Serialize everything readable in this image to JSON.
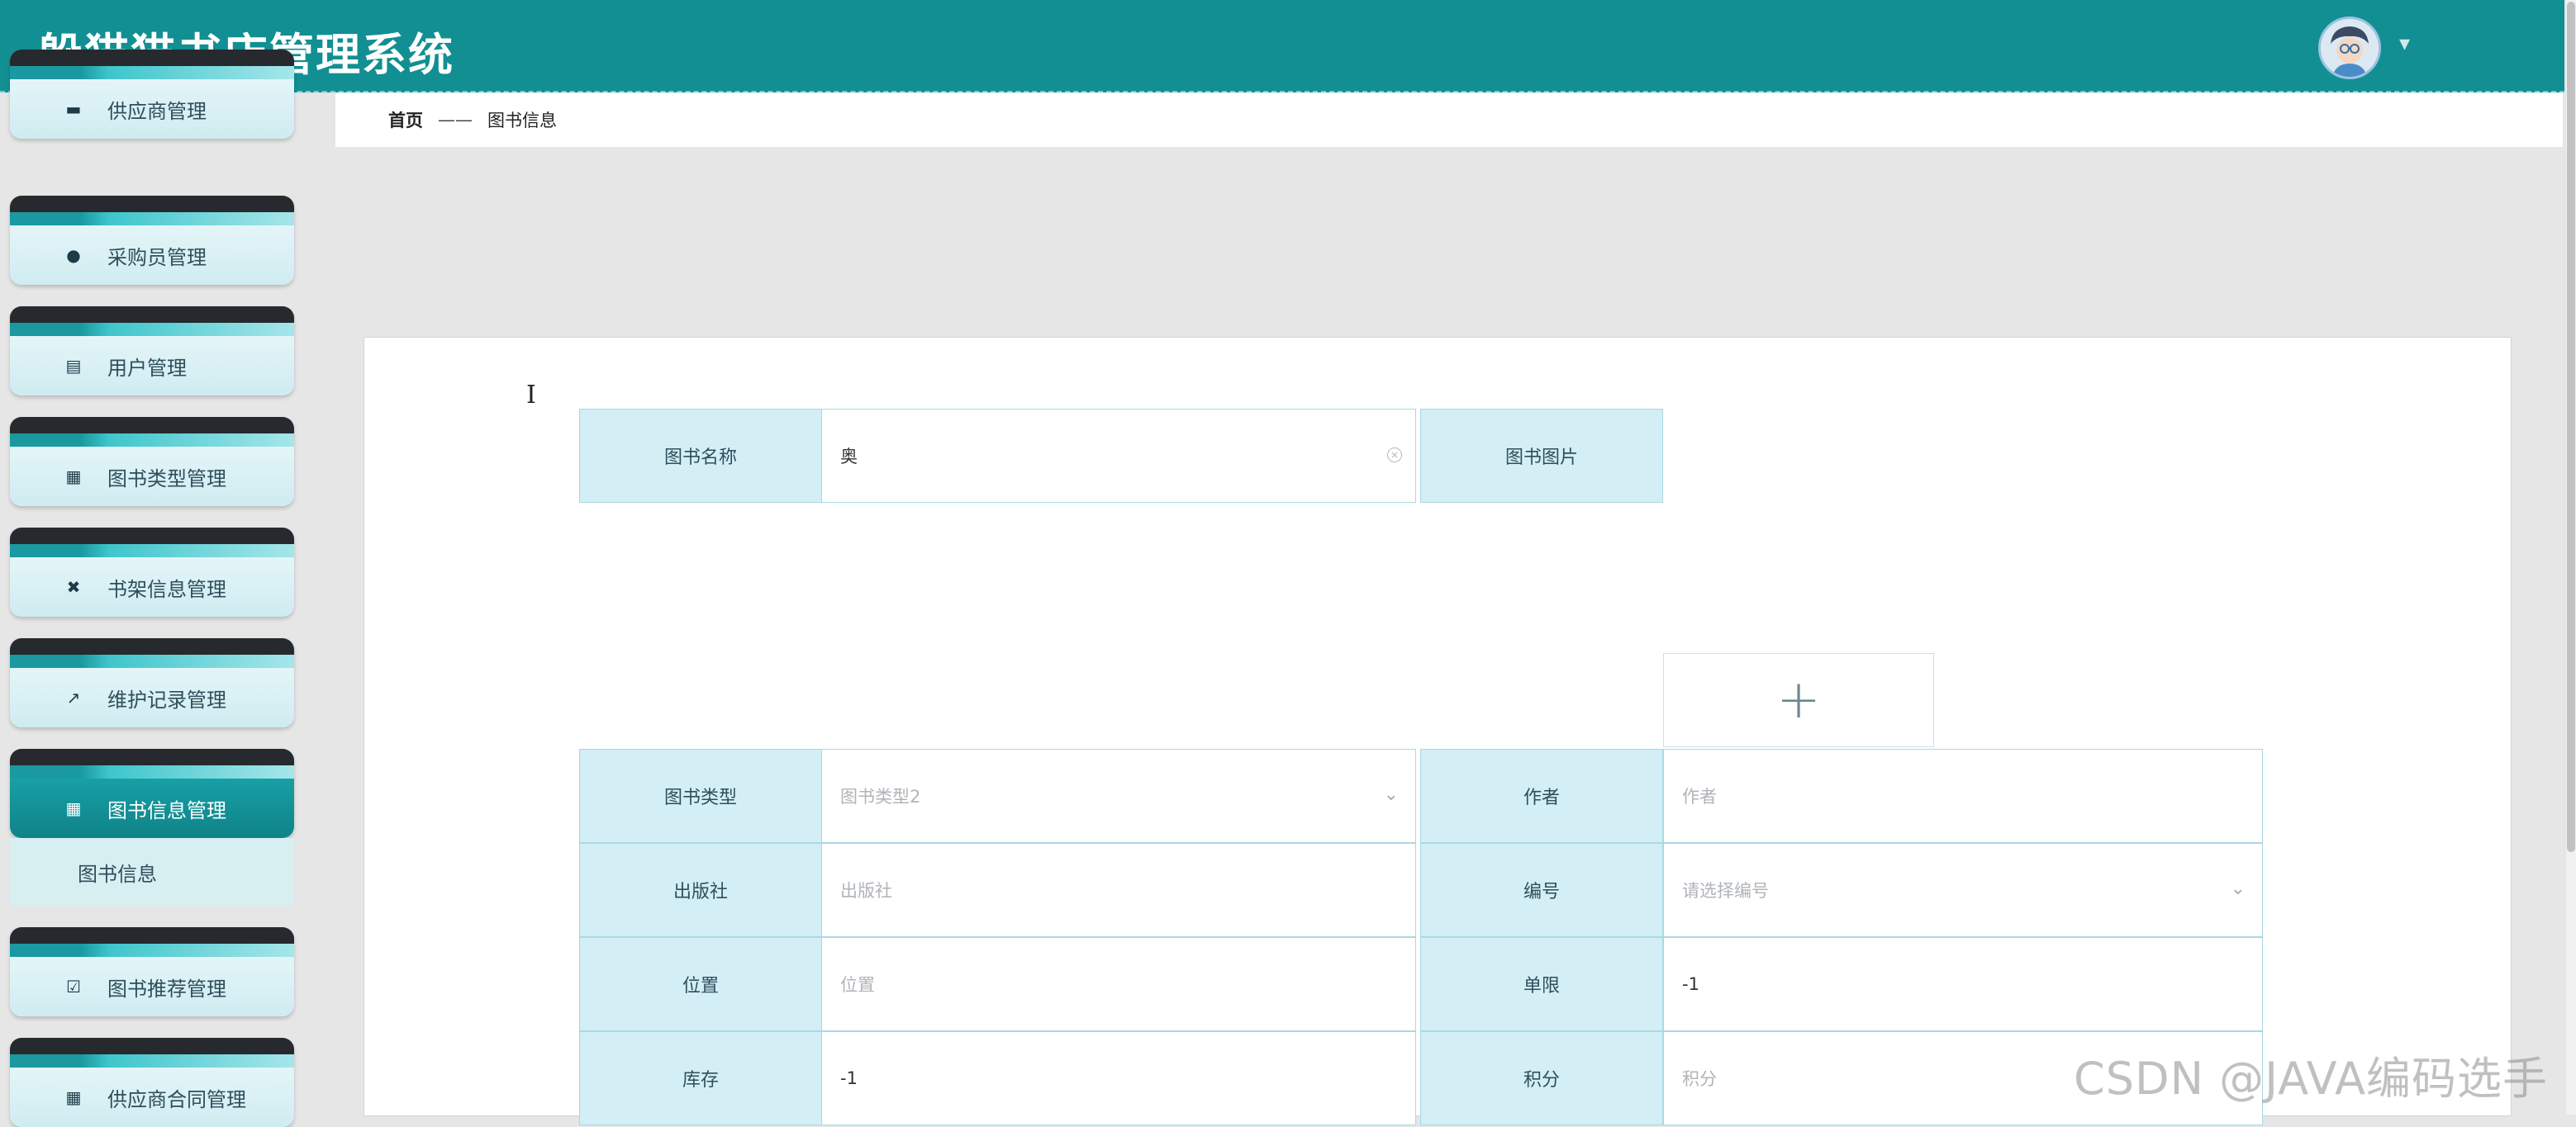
{
  "app": {
    "title": "躲猫猫书店管理系统"
  },
  "header": {
    "avatar_icon": "user-avatar-icon",
    "menu_caret": "▾"
  },
  "sidebar": {
    "items": [
      {
        "label": "供应商管理",
        "icon": "card-icon",
        "glyph": "▬",
        "active": false
      },
      {
        "label": "采购员管理",
        "icon": "person-icon",
        "glyph": "👤",
        "active": false
      },
      {
        "label": "用户管理",
        "icon": "clipboard-icon",
        "glyph": "▤",
        "active": false
      },
      {
        "label": "图书类型管理",
        "icon": "grid-icon",
        "glyph": "▦",
        "active": false
      },
      {
        "label": "书架信息管理",
        "icon": "ticket-icon",
        "glyph": "✖",
        "active": false
      },
      {
        "label": "维护记录管理",
        "icon": "chart-icon",
        "glyph": "↗",
        "active": false
      },
      {
        "label": "图书信息管理",
        "icon": "grid-icon",
        "glyph": "▦",
        "active": true
      },
      {
        "label": "图书推荐管理",
        "icon": "clipboard-check-icon",
        "glyph": "☑",
        "active": false
      },
      {
        "label": "供应商合同管理",
        "icon": "grid-icon",
        "glyph": "▦",
        "active": false
      }
    ],
    "submenu": {
      "label": "图书信息"
    }
  },
  "breadcrumb": {
    "home": "首页",
    "separator": "——",
    "current": "图书信息"
  },
  "form": {
    "book_name": {
      "label": "图书名称",
      "value": "奥"
    },
    "book_image": {
      "label": "图书图片",
      "upload_symbol": "+"
    },
    "book_type": {
      "label": "图书类型",
      "value": "图书类型2"
    },
    "author": {
      "label": "作者",
      "placeholder": "作者"
    },
    "publisher": {
      "label": "出版社",
      "placeholder": "出版社"
    },
    "number": {
      "label": "编号",
      "placeholder": "请选择编号"
    },
    "location": {
      "label": "位置",
      "placeholder": "位置"
    },
    "limit": {
      "label": "单限",
      "value": "-1"
    },
    "stock": {
      "label": "库存",
      "value": "-1"
    },
    "points": {
      "label": "积分",
      "placeholder": "积分"
    }
  },
  "watermark": "CSDN @JAVA编码选手"
}
